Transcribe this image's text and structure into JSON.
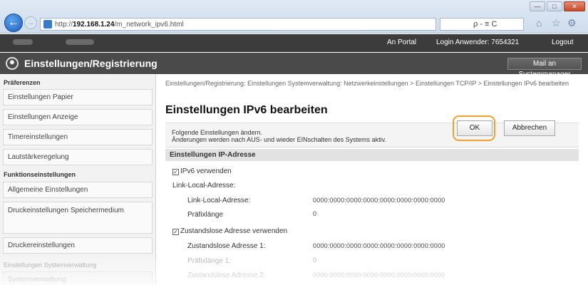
{
  "browser": {
    "url_prefix": "http://",
    "url_host": "192.168.1.24",
    "url_path": "/m_network_ipv6.html",
    "search_text": "ρ - ≡ C",
    "window_controls": [
      "—",
      "□",
      "✕"
    ]
  },
  "topbar": {
    "portal": "An Portal",
    "login_user": "Login Anwender:  7654321",
    "logout": "Logout"
  },
  "header": {
    "title": "Einstellungen/Registrierung",
    "mail_button": "Mail an Systemmanager"
  },
  "sidebar": {
    "section1": "Präferenzen",
    "items1": [
      "Einstellungen Papier",
      "Einstellungen Anzeige",
      "Timereinstellungen",
      "Lautstärkeregelung"
    ],
    "section2": "Funktionseinstellungen",
    "items2": [
      "Allgemeine Einstellungen",
      "Druckeinstellungen Speichermedium",
      "Druckereinstellungen"
    ],
    "section3": "Einstellungen Systemverwaltung",
    "items3": [
      "Systemverwaltung"
    ]
  },
  "main": {
    "breadcrumb": "Einstellungen/Registrierung: Einstellungen Systemverwaltung: Netzwerkeinstellungen > Einstellungen TCP/IP > Einstellungen IPv6 bearbeiten",
    "heading": "Einstellungen IPv6 bearbeiten",
    "info_line1": "Folgende Einstellungen ändern.",
    "info_line2": "Änderungen werden nach AUS- und wieder EINschalten des Systems aktiv.",
    "ok_label": "OK",
    "cancel_label": "Abbrechen",
    "section_title": "Einstellungen IP-Adresse",
    "use_ipv6": "IPv6 verwenden",
    "link_local_head": "Link-Local-Adresse:",
    "link_local_label": "Link-Local-Adresse:",
    "link_local_value": "0000:0000:0000:0000:0000:0000:0000:0000",
    "prefix_label": "Präfixlänge",
    "prefix_value": "0",
    "stateless_label": "Zustandslose Adresse verwenden",
    "stateless1_label": "Zustandslose Adresse 1:",
    "stateless1_value": "0000:0000:0000:0000:0000:0000:0000:0000",
    "prefix1_label": "Präfixlänge 1:",
    "prefix1_value": "0",
    "stateless2_label": "Zustandslose Adresse 2:",
    "stateless2_value": "0000:0000:0000:0000:0000:0000:0000:0000"
  },
  "colors": {
    "highlight_ring": "#f0a030",
    "topbar_bg": "#3c3c3c",
    "titlebar_bg": "#4a4a4a"
  }
}
